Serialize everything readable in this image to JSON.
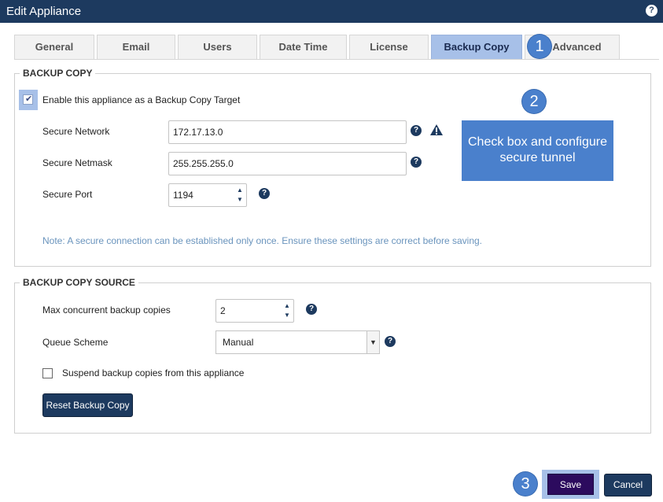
{
  "window": {
    "title": "Edit Appliance",
    "help_glyph": "?"
  },
  "tabs": [
    {
      "label": "General",
      "active": false
    },
    {
      "label": "Email",
      "active": false
    },
    {
      "label": "Users",
      "active": false
    },
    {
      "label": "Date Time",
      "active": false
    },
    {
      "label": "License",
      "active": false
    },
    {
      "label": "Backup Copy",
      "active": true
    },
    {
      "label": "Advanced",
      "active": false
    }
  ],
  "backup_copy": {
    "legend": "BACKUP COPY",
    "enable_label": "Enable this appliance as a Backup Copy Target",
    "enable_checked": true,
    "secure_network_label": "Secure Network",
    "secure_network_value": "172.17.13.0",
    "secure_netmask_label": "Secure Netmask",
    "secure_netmask_value": "255.255.255.0",
    "secure_port_label": "Secure Port",
    "secure_port_value": "1194",
    "note": "Note: A secure connection can be established only once. Ensure these settings are correct before saving."
  },
  "backup_source": {
    "legend": "BACKUP COPY SOURCE",
    "max_concurrent_label": "Max concurrent backup copies",
    "max_concurrent_value": "2",
    "queue_scheme_label": "Queue Scheme",
    "queue_scheme_value": "Manual",
    "suspend_label": "Suspend backup copies from this appliance",
    "suspend_checked": false,
    "reset_button": "Reset Backup Copy"
  },
  "footer": {
    "save": "Save",
    "cancel": "Cancel"
  },
  "callouts": {
    "step1": "1",
    "step2": "2",
    "step3": "3",
    "instruction": "Check box and configure secure tunnel"
  },
  "icons": {
    "help": "question-circle-icon",
    "warning": "warning-triangle-icon",
    "spinner": "spin-arrows-icon",
    "dropdown": "chevron-down-icon",
    "check": "checkmark-icon"
  },
  "colors": {
    "titlebar": "#1d3a5f",
    "active_tab": "#a7c0e8",
    "callout": "#4a80cc",
    "save_button": "#2c0b5e",
    "note_text": "#6a94bd"
  }
}
